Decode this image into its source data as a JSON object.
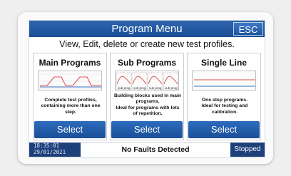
{
  "header": {
    "title": "Program Menu",
    "esc_label": "ESC"
  },
  "subtitle": "View, Edit, delete or create new test profiles.",
  "panels": [
    {
      "title": "Main Programs",
      "desc": [
        "Complete test profiles,",
        "containing more than one",
        "step."
      ],
      "select_label": "Select"
    },
    {
      "title": "Sub Programs",
      "desc": [
        "Building blocks used in main",
        "programs.",
        "Ideal for programs with lots",
        "of repetition."
      ],
      "select_label": "Select",
      "preview_labels": [
        "sub prog",
        "sub prog",
        "sub prog",
        "sub prog"
      ]
    },
    {
      "title": "Single Line",
      "desc": [
        "One step programs.",
        "Ideal for testing and",
        "calibration."
      ],
      "select_label": "Select"
    }
  ],
  "status": {
    "time": "18:35:01",
    "date": "29/01/2021",
    "message": "No Faults Detected",
    "state": "Stopped"
  },
  "colors": {
    "accent": "#1b4f98",
    "status_dark": "#1d3f7a",
    "curve_red": "#e05050",
    "curve_blue": "#3b6fc4"
  }
}
